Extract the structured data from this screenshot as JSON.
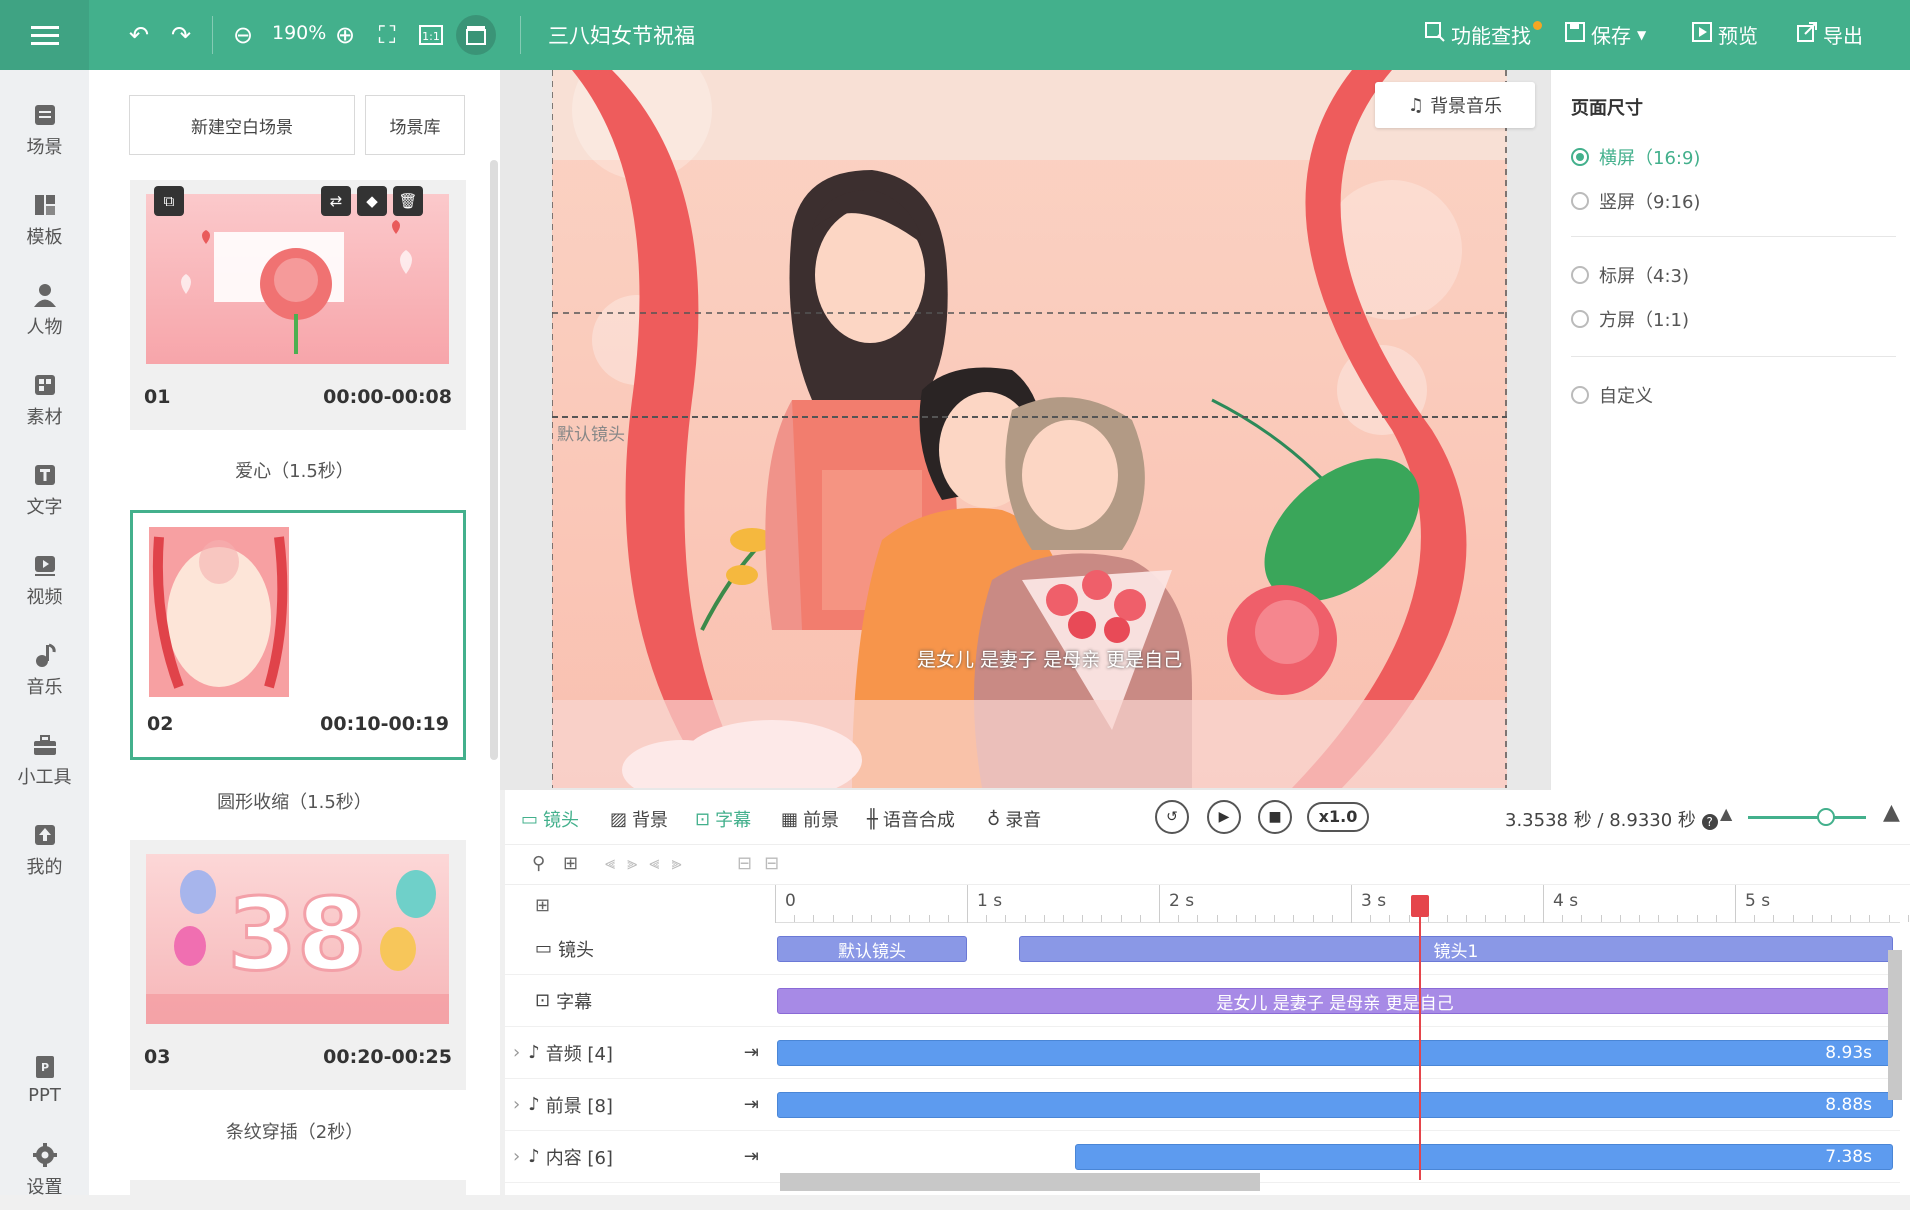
{
  "app": {
    "title": "三八妇女节祝福",
    "zoom": "190%",
    "actions": {
      "search": "功能查找",
      "save": "保存",
      "preview": "预览",
      "export": "导出"
    }
  },
  "nav": [
    {
      "label": "场景",
      "icon": "scene-icon"
    },
    {
      "label": "模板",
      "icon": "template-icon"
    },
    {
      "label": "人物",
      "icon": "person-icon"
    },
    {
      "label": "素材",
      "icon": "material-icon"
    },
    {
      "label": "文字",
      "icon": "text-icon"
    },
    {
      "label": "视频",
      "icon": "video-icon"
    },
    {
      "label": "音乐",
      "icon": "music-icon"
    },
    {
      "label": "小工具",
      "icon": "toolbox-icon"
    },
    {
      "label": "我的",
      "icon": "upload-icon"
    },
    {
      "label": "PPT",
      "icon": "ppt-icon"
    },
    {
      "label": "设置",
      "icon": "settings-icon"
    }
  ],
  "scene_panel": {
    "new_blank": "新建空白场景",
    "library": "场景库",
    "scenes": [
      {
        "no": "01",
        "time": "00:00-00:08",
        "transition": "爱心（1.5秒）"
      },
      {
        "no": "02",
        "time": "00:10-00:19",
        "transition": "圆形收缩（1.5秒）"
      },
      {
        "no": "03",
        "time": "00:20-00:25",
        "transition": "条纹穿插（2秒）"
      }
    ]
  },
  "stage": {
    "bgm_button": "背景音乐",
    "camera_label": "默认镜头",
    "subtitle": "是女儿  是妻子  是母亲  更是自己"
  },
  "page_size": {
    "title": "页面尺寸",
    "options": [
      {
        "label": "横屏（16:9)",
        "selected": true
      },
      {
        "label": "竖屏（9:16)",
        "selected": false
      },
      {
        "label": "标屏（4:3)",
        "selected": false
      },
      {
        "label": "方屏（1:1)",
        "selected": false
      },
      {
        "label": "自定义",
        "selected": false
      }
    ]
  },
  "timeline": {
    "tabs": [
      "镜头",
      "背景",
      "字幕",
      "前景",
      "语音合成",
      "录音"
    ],
    "speed": "x1.0",
    "time": "3.3538 秒 / 8.9330 秒",
    "ruler": [
      "0",
      "1 s",
      "2 s",
      "3 s",
      "4 s",
      "5 s"
    ],
    "tracks": [
      {
        "label": "镜头",
        "clips": [
          "默认镜头",
          "镜头1"
        ]
      },
      {
        "label": "字幕",
        "clips": [
          "是女儿  是妻子  是母亲  更是自己"
        ]
      },
      {
        "label": "音频 [4]",
        "clips": [
          "8.93s"
        ]
      },
      {
        "label": "前景 [8]",
        "clips": [
          "8.88s"
        ]
      },
      {
        "label": "内容 [6]",
        "clips": [
          "7.38s"
        ]
      }
    ],
    "playhead_seconds": 3.3538,
    "total_seconds": 8.933
  },
  "colors": {
    "accent": "#43b08c",
    "playhead": "#e5454b"
  }
}
